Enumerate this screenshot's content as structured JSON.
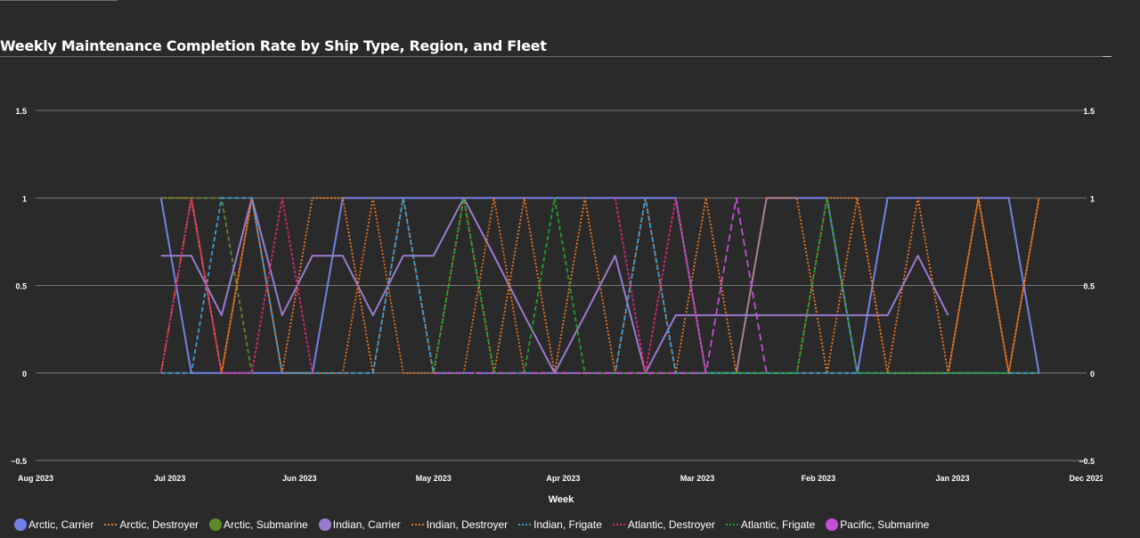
{
  "chart_data": {
    "type": "line",
    "title": "Weekly Maintenance Completion Rate by Ship Type, Region, and Fleet",
    "xlabel": "Week",
    "ylabel": "",
    "x_range": [
      "2023-08-01",
      "2022-12-01"
    ],
    "x_ticks": [
      "Aug 2023",
      "Jul 2023",
      "Jun 2023",
      "May 2023",
      "Apr 2023",
      "Mar 2023",
      "Feb 2023",
      "Jan 2023",
      "Dec 2022"
    ],
    "ylim": [
      -0.5,
      1.5
    ],
    "y_ticks": [
      "−0.5",
      "0",
      "0.5",
      "1",
      "1.5"
    ],
    "grid": true,
    "legend_position": "bottom",
    "dates": [
      "2023-07-03",
      "2023-06-26",
      "2023-06-19",
      "2023-06-12",
      "2023-06-05",
      "2023-05-29",
      "2023-05-22",
      "2023-05-15",
      "2023-05-08",
      "2023-05-01",
      "2023-04-24",
      "2023-04-17",
      "2023-04-10",
      "2023-04-03",
      "2023-03-27",
      "2023-03-20",
      "2023-03-13",
      "2023-03-06",
      "2023-02-27",
      "2023-02-20",
      "2023-02-13",
      "2023-02-06",
      "2023-01-30",
      "2023-01-23",
      "2023-01-16",
      "2023-01-09",
      "2023-01-02",
      "2022-12-26",
      "2022-12-19",
      "2022-12-12",
      "2022-12-05"
    ],
    "series": [
      {
        "name": "Arctic, Carrier",
        "color": "#7480e8",
        "style": "solid",
        "values": [
          1,
          0,
          0,
          0,
          0,
          0,
          1,
          1,
          1,
          1,
          1,
          1,
          1,
          1,
          1,
          1,
          1,
          1,
          0,
          0,
          1,
          1,
          1,
          0,
          1,
          1,
          1,
          1,
          1,
          0,
          null
        ]
      },
      {
        "name": "Arctic, Destroyer",
        "color": "#f27b23",
        "style": "dotted",
        "values": [
          1,
          1,
          0,
          1,
          0,
          1,
          1,
          0,
          1,
          0,
          1,
          0,
          1,
          0,
          1,
          0,
          1,
          0,
          1,
          0,
          1,
          1,
          0,
          1,
          0,
          1,
          0,
          1,
          0,
          1,
          null
        ]
      },
      {
        "name": "Arctic, Submarine",
        "color": "#5c8a2a",
        "style": "dashed",
        "values": [
          1,
          1,
          1,
          0,
          null,
          null,
          null,
          null,
          null,
          null,
          null,
          null,
          null,
          null,
          null,
          null,
          null,
          null,
          null,
          null,
          null,
          null,
          null,
          null,
          null,
          0,
          0,
          0,
          0,
          0,
          null
        ]
      },
      {
        "name": "Indian, Carrier",
        "color": "#9a7bd0",
        "style": "solid",
        "values": [
          0.67,
          0.67,
          0.33,
          1,
          0.33,
          0.67,
          0.67,
          0.33,
          0.67,
          0.67,
          1,
          0.67,
          0.33,
          0,
          0.33,
          0.67,
          0,
          0.33,
          0.33,
          0.33,
          0.33,
          0.33,
          0.33,
          0.33,
          0.33,
          0.67,
          0.33,
          null,
          null,
          null,
          null
        ]
      },
      {
        "name": "Indian, Destroyer",
        "color": "#e8711e",
        "style": "dotted",
        "values": [
          0,
          1,
          0,
          1,
          0,
          0,
          0,
          1,
          0,
          0,
          0,
          1,
          0,
          0,
          0,
          0,
          0,
          0,
          0,
          0,
          0,
          0,
          1,
          1,
          0,
          0,
          0,
          1,
          0,
          1,
          null
        ]
      },
      {
        "name": "Indian, Frigate",
        "color": "#3a9fd8",
        "style": "dashed",
        "values": [
          0,
          0,
          1,
          1,
          0,
          0,
          0,
          0,
          1,
          0,
          0,
          0,
          0,
          0,
          0,
          0,
          1,
          0,
          0,
          0,
          0,
          0,
          0,
          0,
          0,
          0,
          0,
          0,
          0,
          0,
          null
        ]
      },
      {
        "name": "Atlantic, Destroyer",
        "color": "#e0277a",
        "style": "dashdot",
        "values": [
          0,
          1,
          0,
          0,
          1,
          0,
          null,
          null,
          null,
          null,
          null,
          null,
          null,
          null,
          null,
          1,
          0,
          1,
          0,
          null,
          null,
          null,
          null,
          null,
          null,
          null,
          null,
          null,
          null,
          null,
          null
        ]
      },
      {
        "name": "Atlantic, Frigate",
        "color": "#22a02c",
        "style": "dashed",
        "values": [
          null,
          null,
          null,
          null,
          null,
          null,
          null,
          null,
          null,
          0,
          1,
          0,
          0,
          1,
          0,
          0,
          0,
          0,
          0,
          0,
          0,
          0,
          1,
          0,
          0,
          0,
          0,
          0,
          0,
          null,
          null
        ]
      },
      {
        "name": "Pacific, Submarine",
        "color": "#c34fd6",
        "style": "longdash",
        "values": [
          null,
          null,
          null,
          null,
          null,
          null,
          null,
          null,
          null,
          0,
          0,
          0,
          0,
          0,
          0,
          0,
          0,
          0,
          0,
          1,
          0,
          null,
          null,
          null,
          null,
          null,
          null,
          null,
          null,
          null,
          null
        ]
      }
    ]
  },
  "legend_markers": [
    "dot",
    "dash",
    "dot",
    "dot",
    "dash",
    "dash",
    "dash",
    "dash",
    "dot"
  ]
}
